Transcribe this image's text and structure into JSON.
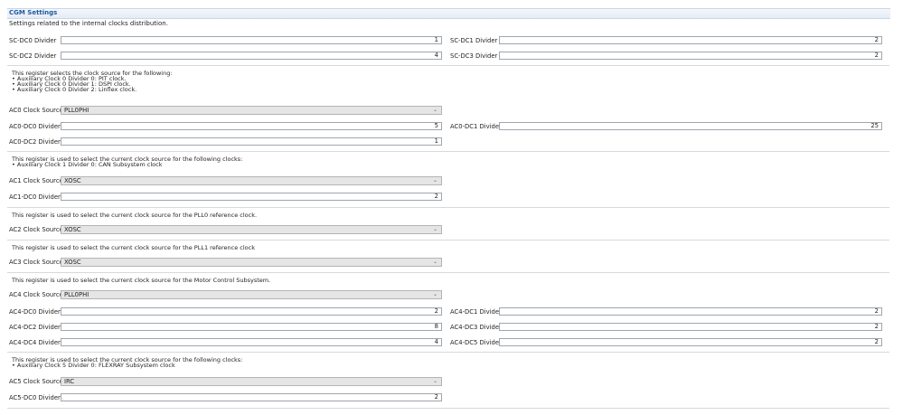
{
  "header": {
    "title": "CGM Settings",
    "description": "Settings related to the internal clocks distribution."
  },
  "sc_dividers": {
    "sc_dc0": {
      "label": "SC-DC0 Divider",
      "value": "1"
    },
    "sc_dc1": {
      "label": "SC-DC1 Divider",
      "value": "2"
    },
    "sc_dc2": {
      "label": "SC-DC2 Divider",
      "value": "4"
    },
    "sc_dc3": {
      "label": "SC-DC3 Divider",
      "value": "2"
    }
  },
  "ac0": {
    "description": "This register selects the clock source for the following:\n• Auxiliary Clock 0 Divider 0: PIT clock.\n• Auxiliary Clock 0 Divider 1: DSPI clock.\n• Auxiliary Clock 0 Divider 2: Linflex clock.",
    "source_label": "AC0 Clock Source",
    "source_value": "PLL0PHI",
    "dc0": {
      "label": "AC0-DC0 Divider",
      "value": "5"
    },
    "dc1": {
      "label": "AC0-DC1 Divider",
      "value": "25"
    },
    "dc2": {
      "label": "AC0-DC2 Divider",
      "value": "1"
    }
  },
  "ac1": {
    "description": "This register is used to select the current clock source for the following clocks:\n• Auxiliary Clock 1 Divider 0: CAN Subsystem clock",
    "source_label": "AC1 Clock Source",
    "source_value": "XOSC",
    "dc0": {
      "label": "AC1-DC0 Divider",
      "value": "2"
    }
  },
  "ac2": {
    "description": "This register is used to select the current clock source for the PLL0 reference clock.",
    "source_label": "AC2 Clock Source",
    "source_value": "XOSC"
  },
  "ac3": {
    "description": "This register is used to select the current clock source for the PLL1 reference clock",
    "source_label": "AC3 Clock Source",
    "source_value": "XOSC"
  },
  "ac4": {
    "description": "This register is used to select the current clock source for the Motor Control Subsystem.",
    "source_label": "AC4 Clock Source",
    "source_value": "PLL0PHI",
    "dc0": {
      "label": "AC4-DC0 Divider",
      "value": "2"
    },
    "dc1": {
      "label": "AC4-DC1 Divider",
      "value": "2"
    },
    "dc2": {
      "label": "AC4-DC2 Divider",
      "value": "8"
    },
    "dc3": {
      "label": "AC4-DC3 Divider",
      "value": "2"
    },
    "dc4": {
      "label": "AC4-DC4 Divider",
      "value": "4"
    },
    "dc5": {
      "label": "AC4-DC5 Divider",
      "value": "2"
    }
  },
  "ac5": {
    "description": "This register is used to select the current clock source for the following clocks:\n• Auxiliary Clock 5 Divider 0: FLEXRAY Subsystem clock",
    "source_label": "AC5 Clock Source",
    "source_value": "IRC",
    "dc0": {
      "label": "AC5-DC0 Divider",
      "value": "2"
    }
  },
  "icons": {
    "dropdown": "chevron-down-icon",
    "chevron_glyph": "⌄"
  }
}
